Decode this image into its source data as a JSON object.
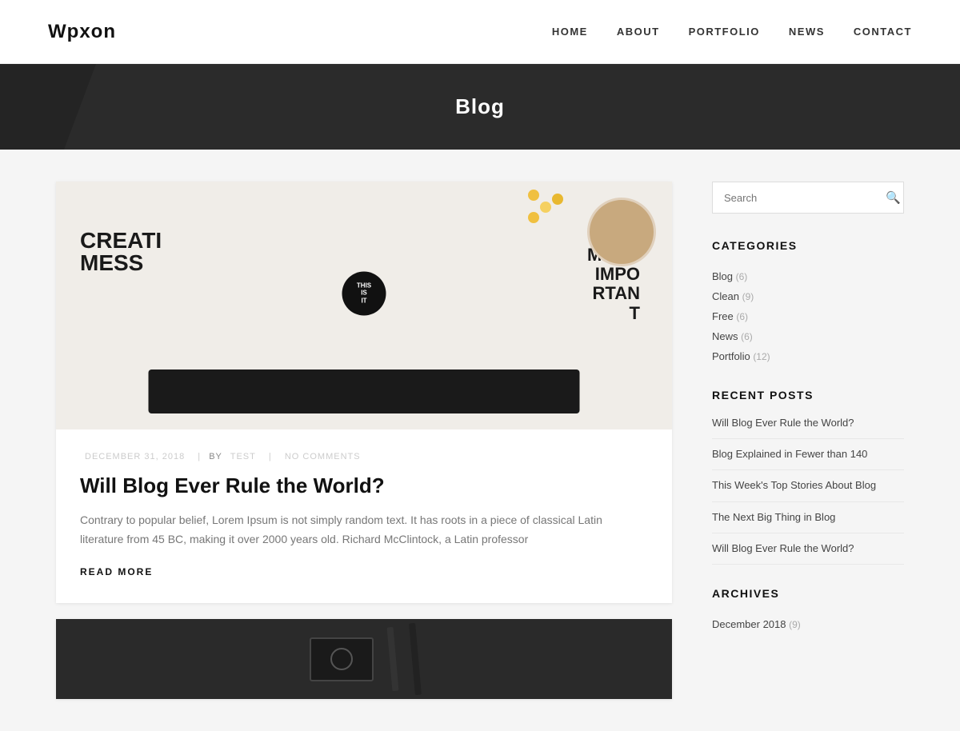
{
  "site": {
    "logo": "Wpxon",
    "nav": [
      {
        "label": "HOME",
        "href": "#"
      },
      {
        "label": "ABOUT",
        "href": "#"
      },
      {
        "label": "PORTFOLIO",
        "href": "#"
      },
      {
        "label": "NEWS",
        "href": "#"
      },
      {
        "label": "CONTACT",
        "href": "#"
      }
    ]
  },
  "hero": {
    "title": "Blog"
  },
  "posts": [
    {
      "date": "DECEMBER 31, 2018",
      "author": "TEST",
      "comments": "NO COMMENTS",
      "title": "Will Blog Ever Rule the World?",
      "excerpt": "Contrary to popular belief, Lorem Ipsum is not simply random text. It has roots in a piece of classical Latin literature from 45 BC, making it over 2000 years old. Richard McClintock, a Latin professor",
      "read_more": "READ MORE"
    }
  ],
  "sidebar": {
    "search_placeholder": "Search",
    "categories_title": "CATEGORIES",
    "categories": [
      {
        "name": "Blog",
        "count": "6"
      },
      {
        "name": "Clean",
        "count": "9"
      },
      {
        "name": "Free",
        "count": "6"
      },
      {
        "name": "News",
        "count": "6"
      },
      {
        "name": "Portfolio",
        "count": "12"
      }
    ],
    "recent_posts_title": "RECENT POSTS",
    "recent_posts": [
      {
        "title": "Will Blog Ever Rule the World?"
      },
      {
        "title": "Blog Explained in Fewer than 140"
      },
      {
        "title": "This Week's Top Stories About Blog"
      },
      {
        "title": "The Next Big Thing in Blog"
      },
      {
        "title": "Will Blog Ever Rule the World?"
      }
    ],
    "archives_title": "ARCHIVES",
    "archives": [
      {
        "label": "December 2018",
        "count": "9"
      }
    ]
  }
}
